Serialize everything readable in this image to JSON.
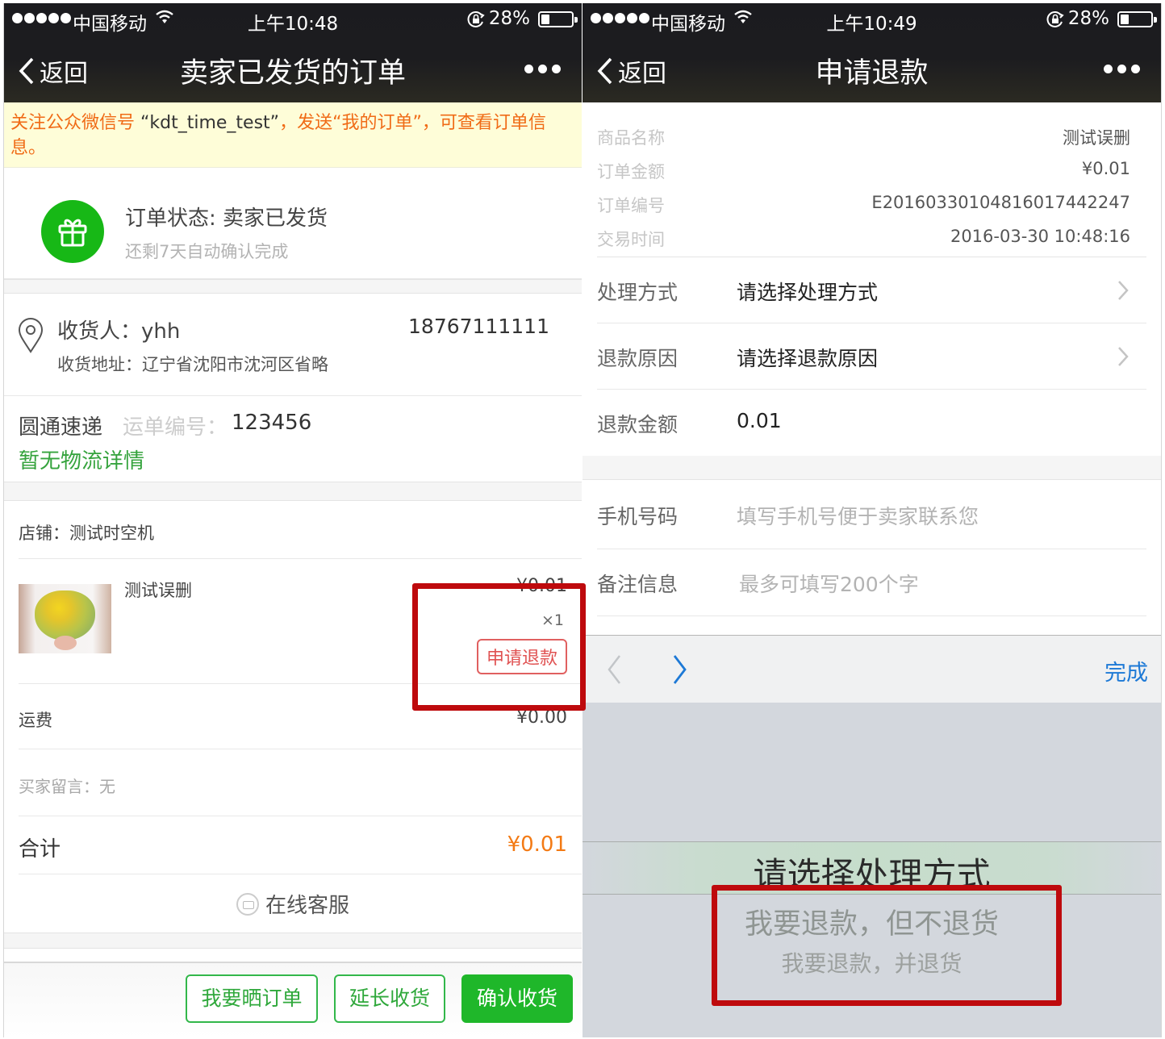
{
  "left": {
    "status_bar": {
      "carrier": "中国移动",
      "time": "上午10:48",
      "battery": "28%",
      "battery_level": 0.28
    },
    "nav": {
      "back": "返回",
      "title": "卖家已发货的订单"
    },
    "notice": {
      "before": "关注公众微信号 ",
      "account": "“kdt_time_test”",
      "after": "，发送“我的订单”，可查看订单信息。"
    },
    "order_status": {
      "title": "订单状态: 卖家已发货",
      "subtitle": "还剩7天自动确认完成"
    },
    "address": {
      "receiver": "收货人：yhh",
      "phone": "18767111111",
      "detail": "收货地址：辽宁省沈阳市沈河区省略"
    },
    "express": {
      "company": "圆通速递",
      "tracking_label": "运单编号：",
      "tracking_no": "123456",
      "logistics_link": "暂无物流详情"
    },
    "shop": {
      "label": "店铺：测试时空机"
    },
    "item": {
      "name": "测试误删",
      "price": "¥0.01",
      "quantity": "×1",
      "refund_button": "申请退款"
    },
    "shipping": {
      "label": "运费",
      "value": "¥0.00"
    },
    "buyer_message": "买家留言：无",
    "total": {
      "label": "合计",
      "value": "¥0.01"
    },
    "customer_service": "在线客服",
    "actions": {
      "share": "我要晒订单",
      "extend": "延长收货",
      "confirm": "确认收货"
    }
  },
  "right": {
    "status_bar": {
      "carrier": "中国移动",
      "time": "上午10:49",
      "battery": "28%",
      "battery_level": 0.28
    },
    "nav": {
      "back": "返回",
      "title": "申请退款"
    },
    "info": [
      {
        "key": "商品名称",
        "value": "测试误删"
      },
      {
        "key": "订单金额",
        "value": "¥0.01"
      },
      {
        "key": "订单编号",
        "value": "E20160330104816017442247"
      },
      {
        "key": "交易时间",
        "value": "2016-03-30 10:48:16"
      }
    ],
    "form": {
      "method": {
        "label": "处理方式",
        "value": "请选择处理方式"
      },
      "reason": {
        "label": "退款原因",
        "value": "请选择退款原因"
      },
      "amount": {
        "label": "退款金额",
        "value": "0.01"
      },
      "phone": {
        "label": "手机号码",
        "placeholder": "填写手机号便于卖家联系您"
      },
      "note": {
        "label": "备注信息",
        "placeholder": "最多可填写200个字"
      }
    },
    "keyboard_toolbar": {
      "done": "完成"
    },
    "picker": {
      "options": [
        "请选择处理方式",
        "我要退款，但不退货",
        "我要退款，并退货"
      ],
      "selected_index": 0
    }
  },
  "colors": {
    "wechat_green": "#1fb72a",
    "price_orange": "#f37a14",
    "refund_red": "#e05252",
    "annotation_red": "#be0a0d",
    "ios_blue": "#1d79d6"
  }
}
